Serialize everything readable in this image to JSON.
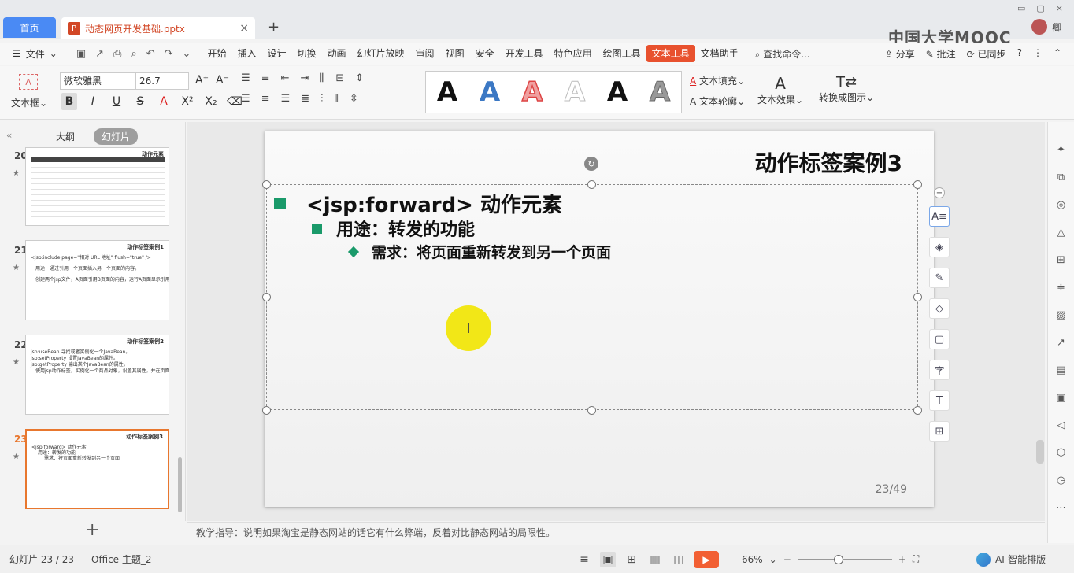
{
  "titlebar": {
    "home_tab": "首页",
    "file_tab": "动态网页开发基础.pptx",
    "file_icon": "P",
    "brand": "中国大学MOOC",
    "user": "卿"
  },
  "menu": {
    "file": "文件",
    "tabs": [
      "开始",
      "插入",
      "设计",
      "切换",
      "动画",
      "幻灯片放映",
      "审阅",
      "视图",
      "安全",
      "开发工具",
      "特色应用",
      "绘图工具",
      "文本工具",
      "文档助手"
    ],
    "active_tab": "文本工具",
    "search": "查找命令...",
    "share": "分享",
    "comment": "批注",
    "sync": "已同步"
  },
  "ribbon": {
    "textbox": "文本框",
    "font": "微软雅黑",
    "size": "26.7",
    "style_letter": "A",
    "text_fill": "文本填充",
    "text_outline": "文本轮廓",
    "text_effect": "文本效果",
    "convert": "转换成图示"
  },
  "panel": {
    "tab_outline": "大纲",
    "tab_slides": "幻灯片",
    "slides": [
      {
        "num": "20",
        "title": "动作元素"
      },
      {
        "num": "21",
        "title": "动作标签案例1",
        "lines": [
          "<jsp:include page=\"相对 URL 地址\" flush=\"true\" />",
          "用途：通过引用一个页面插入另一个页面的内容。",
          "创建两个jsp文件，A页面引用B页面的内容，运行A页面显示引用效果。"
        ]
      },
      {
        "num": "22",
        "title": "动作标签案例2",
        "lines": [
          "jsp:useBean          寻找或者实例化一个JavaBean。",
          "jsp:setProperty      设置JavaBean的属性。",
          "jsp:getProperty      输出某个JavaBean的属性。",
          "使用jsp动作标签，实例化一个商品对象，设置其属性，并在页面上打印输出。"
        ]
      },
      {
        "num": "23",
        "title": "动作标签案例3",
        "lines": [
          "<jsp:forward> 动作元素",
          "用途：转发的功能",
          "需求：将页面重新转发到另一个页面"
        ]
      }
    ]
  },
  "slide": {
    "title": "动作标签案例3",
    "bullet1": "<jsp:forward> 动作元素",
    "bullet2": "用途：转发的功能",
    "bullet3": "需求：将页面重新转发到另一个页面",
    "page": "23/49",
    "cursor": "I",
    "bullet_color": "#1a9a6a"
  },
  "notes": "教学指导：说明如果淘宝是静态网站的话它有什么弊端，反着对比静态网站的局限性。",
  "status": {
    "slide_pos": "幻灯片 23 / 23",
    "theme": "Office 主题_2",
    "zoom": "66%",
    "zoom_level": 0.66,
    "ai": "AI-智能排版"
  }
}
